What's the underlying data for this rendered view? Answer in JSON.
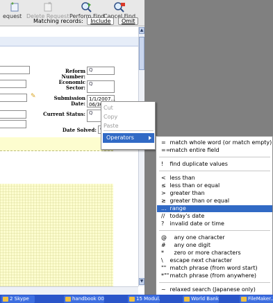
{
  "toolbar": {
    "buttons": [
      {
        "label": "equest",
        "icon": "request-icon",
        "disabled": false
      },
      {
        "label": "Delete Request",
        "icon": "delete-request-icon",
        "disabled": true
      },
      {
        "label": "Perform Find",
        "icon": "perform-find-icon",
        "disabled": false
      },
      {
        "label": "Cancel Find",
        "icon": "cancel-find-icon",
        "disabled": false
      }
    ],
    "matching_label": "Matching records:",
    "include_label": "Include",
    "omit_label": "Omit"
  },
  "form": {
    "reform_number_label": "Reform Number:",
    "economic_sector_label": "Economic\nSector:",
    "submission_date_label": "Submission\nDate:",
    "submission_date_value": "1/1/2007...\n06/30/2007",
    "current_status_label": "Current Status:",
    "date_solved_label": "Date Solved:",
    "find_symbol": "Q"
  },
  "context_menu": {
    "cut": "Cut",
    "copy": "Copy",
    "paste": "Paste",
    "operators": "Operators"
  },
  "operators": {
    "group1": [
      {
        "sym": "=",
        "text": "match whole word (or match empty)"
      },
      {
        "sym": "==",
        "text": "match entire field"
      }
    ],
    "group2": [
      {
        "sym": "!",
        "text": "find duplicate values"
      }
    ],
    "group3": [
      {
        "sym": "<",
        "text": "less than"
      },
      {
        "sym": "≤",
        "text": "less than or equal"
      },
      {
        "sym": ">",
        "text": "greater than"
      },
      {
        "sym": "≥",
        "text": "greater than or equal"
      },
      {
        "sym": "...",
        "text": "range"
      },
      {
        "sym": "//",
        "text": "today's date"
      },
      {
        "sym": "?",
        "text": "invalid date or time"
      }
    ],
    "group4": [
      {
        "sym": "@",
        "text": "any one character"
      },
      {
        "sym": "#",
        "text": "any one digit"
      },
      {
        "sym": "*",
        "text": "zero or more characters"
      },
      {
        "sym": "\\",
        "text": "escape next character"
      },
      {
        "sym": "\"\"",
        "text": "match phrase (from word start)"
      },
      {
        "sym": "*\"\"",
        "text": "match phrase (from anywhere)"
      }
    ],
    "group5": [
      {
        "sym": "~",
        "text": "relaxed search (Japanese only)"
      }
    ]
  },
  "taskbar": {
    "items": [
      "2 Skype",
      "handbook 00...",
      "15 Modul...",
      "World Bank...",
      "FileMaker..."
    ]
  },
  "colors": {
    "selection": "#316ac5",
    "taskbar": "#2a55c9",
    "yellow_area": "#fdfdcf"
  }
}
